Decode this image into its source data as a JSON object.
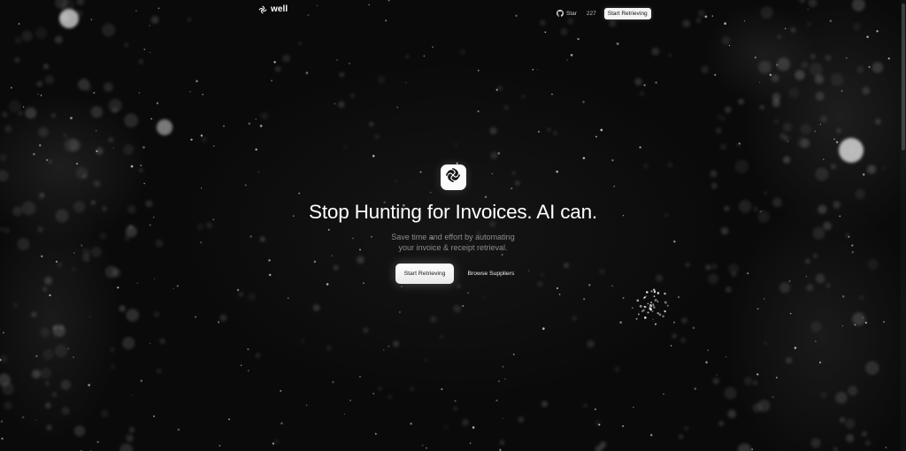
{
  "nav": {
    "brand_name": "well",
    "brand_icon": "spiral-logo-icon",
    "github_icon": "github-icon",
    "star_label": "Star",
    "star_count": "227",
    "cta_label": "Start Retrieving"
  },
  "hero": {
    "logo_icon": "spiral-logo-icon",
    "headline": "Stop Hunting for Invoices. AI can.",
    "subtext_line1": "Save time and effort by automating",
    "subtext_line2": "your invoice & receipt retrieval.",
    "primary_cta": "Start Retrieving",
    "secondary_cta": "Browse Suppliers"
  },
  "colors": {
    "background": "#0b0b0b",
    "text": "#ffffff",
    "muted_text": "#8c8c8c",
    "button_bg": "#f4f4f4",
    "button_text": "#111111"
  }
}
